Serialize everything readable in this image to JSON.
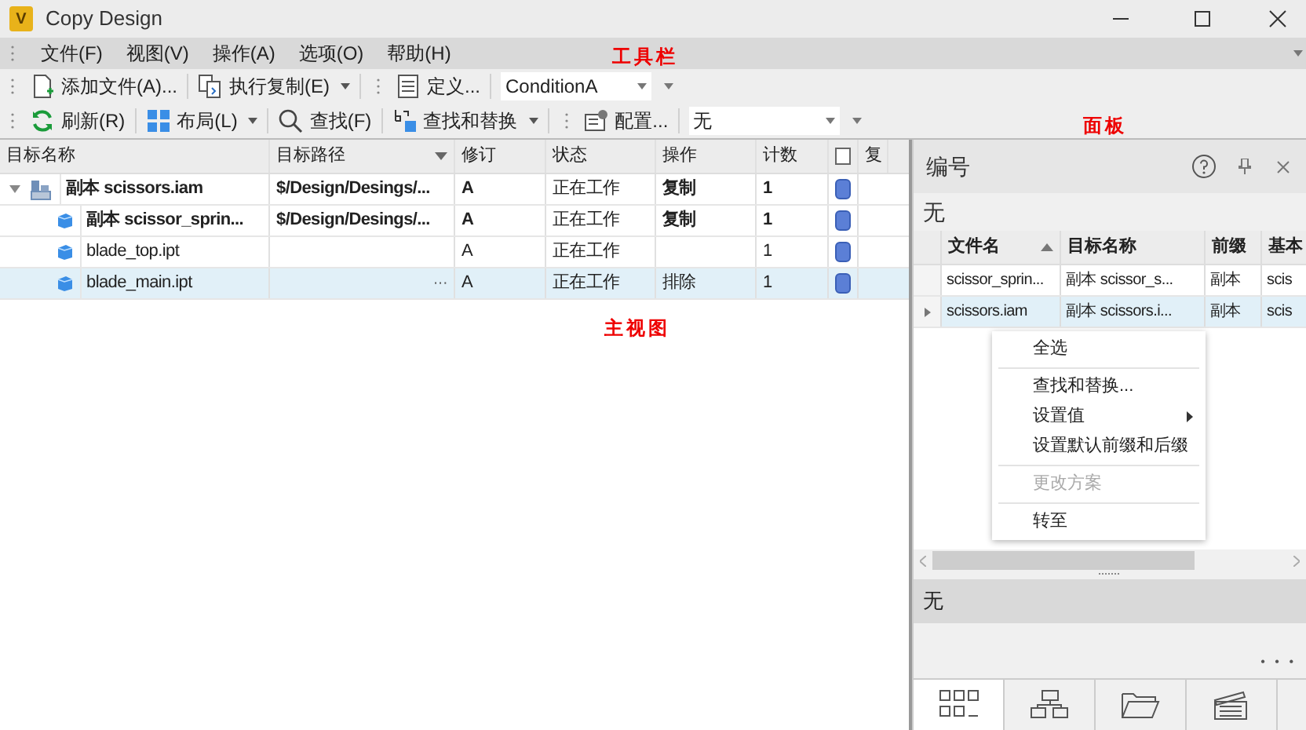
{
  "window": {
    "title": "Copy Design",
    "logo_letter": "V"
  },
  "menu": [
    "文件(F)",
    "视图(V)",
    "操作(A)",
    "选项(O)",
    "帮助(H)"
  ],
  "toolbars": [
    [
      {
        "kind": "button",
        "label": "添加文件(A)...",
        "dropdown": false
      },
      {
        "kind": "button",
        "label": "执行复制(E)",
        "dropdown": true
      },
      {
        "kind": "grip"
      },
      {
        "kind": "button",
        "label": "定义...",
        "dropdown": false
      },
      {
        "kind": "combo",
        "value": "ConditionA"
      },
      {
        "kind": "overflow"
      }
    ],
    [
      {
        "kind": "button",
        "label": "刷新(R)",
        "dropdown": false
      },
      {
        "kind": "button",
        "label": "布局(L)",
        "dropdown": true
      },
      {
        "kind": "button",
        "label": "查找(F)",
        "dropdown": false
      },
      {
        "kind": "button",
        "label": "查找和替换",
        "dropdown": true
      },
      {
        "kind": "grip"
      },
      {
        "kind": "button",
        "label": "配置...",
        "dropdown": false
      },
      {
        "kind": "combo",
        "value": "无"
      },
      {
        "kind": "overflow"
      }
    ]
  ],
  "annotations": [
    {
      "text": "工具栏"
    },
    {
      "text": "面板"
    },
    {
      "text": "主视图"
    }
  ],
  "main_grid": {
    "columns": [
      "目标名称",
      "目标路径",
      "修订",
      "状态",
      "操作",
      "计数",
      "复"
    ],
    "check_all": false,
    "rows": [
      {
        "kind": "assembly",
        "name": "副本 scissors.iam",
        "path": "$/Design/Desings/...",
        "revision": "A",
        "status": "正在工作",
        "action": "复制",
        "count": "1",
        "modified": true,
        "selected": false,
        "expanded": true,
        "children": [
          {
            "kind": "part",
            "name": "副本 scissor_sprin...",
            "path": "$/Design/Desings/...",
            "revision": "A",
            "status": "正在工作",
            "action": "复制",
            "count": "1",
            "modified": true,
            "selected": false
          },
          {
            "kind": "part",
            "name": "blade_top.ipt",
            "revision": "A",
            "status": "正在工作",
            "count": "1",
            "modified": false,
            "selected": false
          },
          {
            "kind": "part",
            "name": "blade_main.ipt",
            "path_button": "···",
            "revision": "A",
            "status": "正在工作",
            "action": "排除",
            "count": "1",
            "modified": false,
            "selected": true
          }
        ]
      }
    ]
  },
  "panel": {
    "title": "编号",
    "scheme": "无",
    "columns": [
      "文件名",
      "目标名称",
      "前缀",
      "基本"
    ],
    "rows": [
      {
        "file": "scissor_sprin...",
        "target": "副本 scissor_s...",
        "prefix": "副本",
        "base": "scis",
        "selected": false
      },
      {
        "file": "scissors.iam",
        "target": "副本 scissors.i...",
        "prefix": "副本",
        "base": "scis",
        "selected": true
      }
    ],
    "context_menu": [
      {
        "kind": "item",
        "label": "全选",
        "disabled": false,
        "submenu": false
      },
      {
        "kind": "sep"
      },
      {
        "kind": "item",
        "label": "查找和替换...",
        "disabled": false,
        "submenu": false
      },
      {
        "kind": "item",
        "label": "设置值",
        "submenu": true,
        "disabled": false
      },
      {
        "kind": "item",
        "label": "设置默认前缀和后缀",
        "disabled": false,
        "submenu": false
      },
      {
        "kind": "sep"
      },
      {
        "kind": "item",
        "label": "更改方案",
        "disabled": true,
        "submenu": false
      },
      {
        "kind": "sep"
      },
      {
        "kind": "item",
        "label": "转至",
        "disabled": false,
        "submenu": false
      }
    ],
    "lower_value": "无",
    "more": "• • •",
    "tabs": [
      {
        "selected": true
      },
      {
        "selected": false
      },
      {
        "selected": false
      },
      {
        "selected": false
      }
    ]
  }
}
